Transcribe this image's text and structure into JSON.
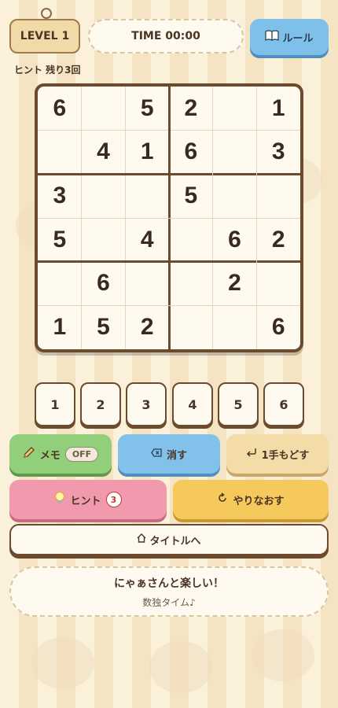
{
  "header": {
    "level_label": "LEVEL 1",
    "timer": "TIME 00:00",
    "rules_label": "ルール",
    "hint_remaining": "ヒント 残り3回"
  },
  "board": {
    "grid": [
      [
        6,
        0,
        5,
        2,
        0,
        1
      ],
      [
        0,
        4,
        1,
        6,
        0,
        3
      ],
      [
        3,
        0,
        0,
        5,
        0,
        0
      ],
      [
        5,
        0,
        4,
        0,
        6,
        2
      ],
      [
        0,
        6,
        0,
        0,
        2,
        0
      ],
      [
        1,
        5,
        2,
        0,
        0,
        6
      ]
    ]
  },
  "number_pad": [
    "1",
    "2",
    "3",
    "4",
    "5",
    "6"
  ],
  "actions": {
    "memo_label": "メモ",
    "memo_state": "OFF",
    "erase_label": "消す",
    "undo_label": "1手もどす",
    "hint_label": "ヒント",
    "hint_count": "3",
    "restart_label": "やりなおす",
    "title_label": "タイトルへ"
  },
  "message": {
    "line1": "にゃぁさんと楽しい！",
    "line2": "数独タイム♪"
  },
  "icons": {
    "rules": "book-icon",
    "memo": "pencil-icon",
    "erase": "backspace-icon",
    "undo": "return-arrow-icon",
    "hint": "lightbulb-icon",
    "restart": "refresh-icon",
    "title": "home-icon"
  }
}
